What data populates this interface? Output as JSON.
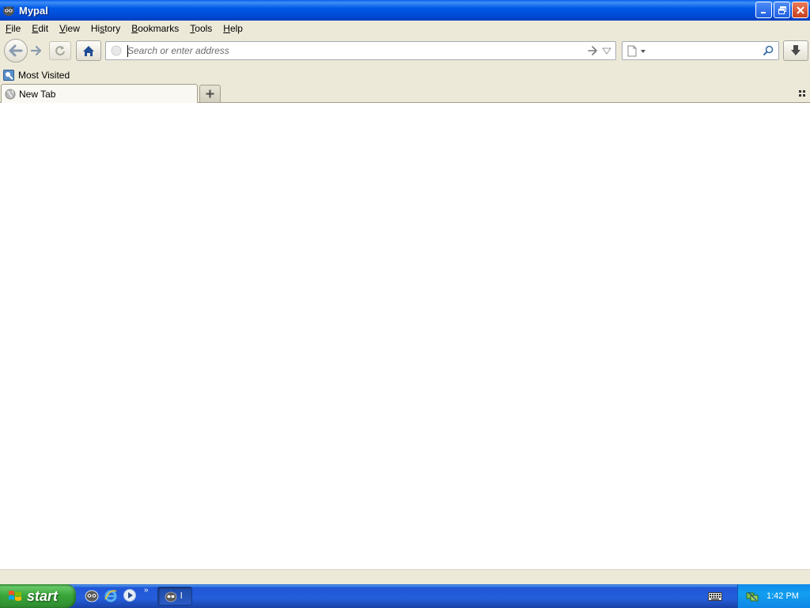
{
  "window": {
    "title": "Mypal",
    "controls": [
      "minimize",
      "restore",
      "close"
    ]
  },
  "menubar": {
    "items": [
      {
        "label": "File",
        "accel": "F",
        "rest": "ile"
      },
      {
        "label": "Edit",
        "accel": "E",
        "rest": "dit"
      },
      {
        "label": "View",
        "accel": "V",
        "rest": "iew"
      },
      {
        "label": "History",
        "accel": "s",
        "pre": "Hi",
        "rest": "tory"
      },
      {
        "label": "Bookmarks",
        "accel": "B",
        "rest": "ookmarks"
      },
      {
        "label": "Tools",
        "accel": "T",
        "rest": "ools"
      },
      {
        "label": "Help",
        "accel": "H",
        "rest": "elp"
      }
    ]
  },
  "navbar": {
    "back_icon": "back-arrow-icon",
    "forward_icon": "forward-arrow-icon",
    "reload_icon": "reload-icon",
    "home_icon": "home-icon",
    "url": {
      "value": "",
      "placeholder": "Search or enter address"
    },
    "search": {
      "value": "",
      "placeholder": ""
    },
    "download_icon": "download-arrow-icon"
  },
  "bookmarks": {
    "items": [
      {
        "label": "Most Visited",
        "icon": "most-visited-icon"
      }
    ]
  },
  "tabs": {
    "items": [
      {
        "label": "New Tab",
        "icon": "globe-icon",
        "selected": true
      }
    ],
    "new_tab_icon": "plus-icon",
    "list_all_icon": "grid-icon"
  },
  "taskbar": {
    "start_label": "start",
    "quick_launch": [
      "mypal-icon",
      "internet-explorer-icon",
      "media-player-icon"
    ],
    "quick_launch_more": "»",
    "tasks": [
      {
        "label": "l",
        "icon": "mypal-icon"
      }
    ],
    "clock": "1:42 PM"
  },
  "colors": {
    "titlebar": "#0054E3",
    "taskbar": "#245EDB",
    "start_button": "#3AA73A",
    "tray": "#0F8BEA",
    "chrome": "#ECE9D8",
    "content": "#FFFFFF"
  }
}
